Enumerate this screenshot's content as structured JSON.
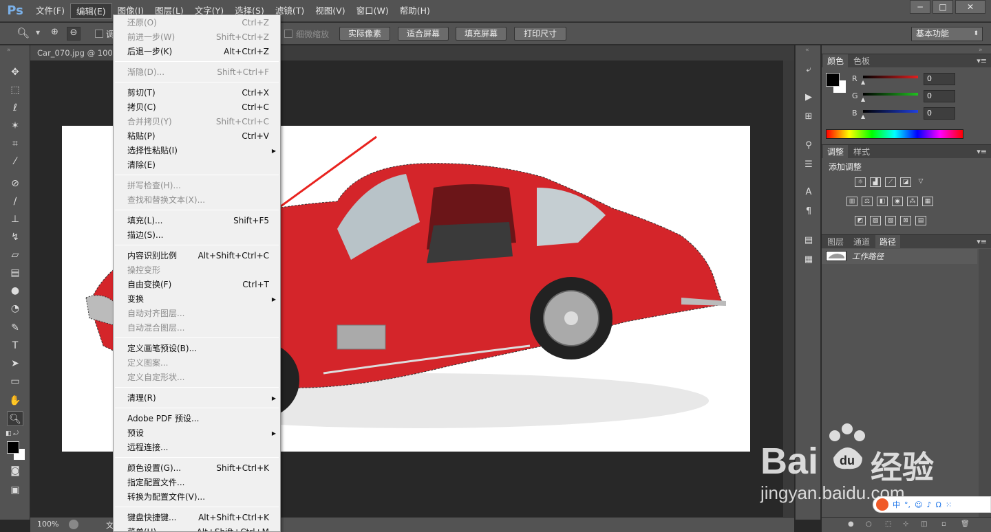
{
  "menubar": {
    "logo": "Ps",
    "items": [
      "文件(F)",
      "编辑(E)",
      "图像(I)",
      "图层(L)",
      "文字(Y)",
      "选择(S)",
      "滤镜(T)",
      "视图(V)",
      "窗口(W)",
      "帮助(H)"
    ],
    "window_buttons": [
      "−",
      "□",
      "✕"
    ]
  },
  "options": {
    "checkbox_label_1": "调",
    "checkbox_label_2": "细微缩放",
    "buttons": [
      "实际像素",
      "适合屏幕",
      "填充屏幕",
      "打印尺寸"
    ],
    "workspace": "基本功能"
  },
  "document": {
    "tab_title": "Car_070.jpg @ 100"
  },
  "status": {
    "zoom": "100%",
    "doc_label": "文"
  },
  "edit_menu": [
    {
      "label": "还原(O)",
      "shortcut": "Ctrl+Z",
      "disabled": true
    },
    {
      "label": "前进一步(W)",
      "shortcut": "Shift+Ctrl+Z",
      "disabled": true
    },
    {
      "label": "后退一步(K)",
      "shortcut": "Alt+Ctrl+Z",
      "disabled": false
    },
    {
      "sep": true
    },
    {
      "label": "渐隐(D)...",
      "shortcut": "Shift+Ctrl+F",
      "disabled": true
    },
    {
      "sep": true
    },
    {
      "label": "剪切(T)",
      "shortcut": "Ctrl+X",
      "disabled": false
    },
    {
      "label": "拷贝(C)",
      "shortcut": "Ctrl+C",
      "disabled": false
    },
    {
      "label": "合并拷贝(Y)",
      "shortcut": "Shift+Ctrl+C",
      "disabled": true
    },
    {
      "label": "粘贴(P)",
      "shortcut": "Ctrl+V",
      "disabled": false
    },
    {
      "label": "选择性粘贴(I)",
      "shortcut": "",
      "submenu": true,
      "disabled": false
    },
    {
      "label": "清除(E)",
      "shortcut": "",
      "disabled": false
    },
    {
      "sep": true
    },
    {
      "label": "拼写检查(H)...",
      "shortcut": "",
      "disabled": true
    },
    {
      "label": "查找和替换文本(X)...",
      "shortcut": "",
      "disabled": true
    },
    {
      "sep": true
    },
    {
      "label": "填充(L)...",
      "shortcut": "Shift+F5",
      "disabled": false
    },
    {
      "label": "描边(S)...",
      "shortcut": "",
      "disabled": false
    },
    {
      "sep": true
    },
    {
      "label": "内容识别比例",
      "shortcut": "Alt+Shift+Ctrl+C",
      "disabled": false
    },
    {
      "label": "操控变形",
      "shortcut": "",
      "disabled": true
    },
    {
      "label": "自由变换(F)",
      "shortcut": "Ctrl+T",
      "disabled": false
    },
    {
      "label": "变换",
      "shortcut": "",
      "submenu": true,
      "disabled": false
    },
    {
      "label": "自动对齐图层...",
      "shortcut": "",
      "disabled": true
    },
    {
      "label": "自动混合图层...",
      "shortcut": "",
      "disabled": true
    },
    {
      "sep": true
    },
    {
      "label": "定义画笔预设(B)...",
      "shortcut": "",
      "disabled": false
    },
    {
      "label": "定义图案...",
      "shortcut": "",
      "disabled": true
    },
    {
      "label": "定义自定形状...",
      "shortcut": "",
      "disabled": true
    },
    {
      "sep": true
    },
    {
      "label": "清理(R)",
      "shortcut": "",
      "submenu": true,
      "disabled": false
    },
    {
      "sep": true
    },
    {
      "label": "Adobe PDF 预设...",
      "shortcut": "",
      "disabled": false
    },
    {
      "label": "预设",
      "shortcut": "",
      "submenu": true,
      "disabled": false
    },
    {
      "label": "远程连接...",
      "shortcut": "",
      "disabled": false
    },
    {
      "sep": true
    },
    {
      "label": "颜色设置(G)...",
      "shortcut": "Shift+Ctrl+K",
      "disabled": false
    },
    {
      "label": "指定配置文件...",
      "shortcut": "",
      "disabled": false
    },
    {
      "label": "转换为配置文件(V)...",
      "shortcut": "",
      "disabled": false
    },
    {
      "sep": true
    },
    {
      "label": "键盘快捷键...",
      "shortcut": "Alt+Shift+Ctrl+K",
      "disabled": false
    },
    {
      "label": "菜单(U)...",
      "shortcut": "Alt+Shift+Ctrl+M",
      "disabled": false
    }
  ],
  "color_panel": {
    "tabs": [
      "颜色",
      "色板"
    ],
    "channels": [
      {
        "name": "R",
        "value": "0",
        "color": "#e02020"
      },
      {
        "name": "G",
        "value": "0",
        "color": "#20c020"
      },
      {
        "name": "B",
        "value": "0",
        "color": "#2040e0"
      }
    ]
  },
  "adjust_panel": {
    "tabs": [
      "调整",
      "样式"
    ],
    "title": "添加调整"
  },
  "layers_panel": {
    "tabs": [
      "图层",
      "通道",
      "路径"
    ],
    "path_name": "工作路径"
  },
  "watermark": {
    "brand": "Bai",
    "brand2": "经验",
    "url": "jingyan.baidu.com"
  }
}
